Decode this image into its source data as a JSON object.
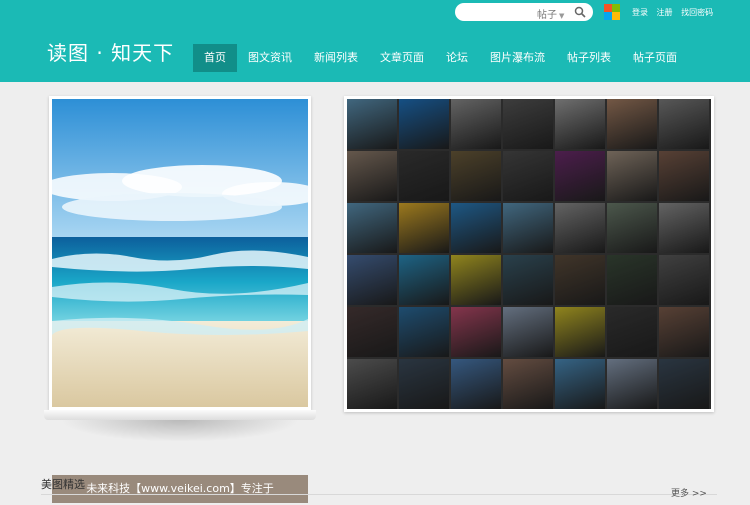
{
  "header": {
    "logo": "读图 · 知天下",
    "search": {
      "type_label": "帖子"
    },
    "top_links": [
      "登录",
      "注册",
      "找回密码"
    ],
    "nav": [
      "首页",
      "图文资讯",
      "新闻列表",
      "文章页面",
      "论坛",
      "图片瀑布流",
      "帖子列表",
      "帖子页面"
    ],
    "active_nav": 0
  },
  "feature": {
    "caption": "未来科技【www.veikei.com】专注于"
  },
  "gallery": {
    "tile_colors": [
      "#5a8fb0",
      "#1e6fb8",
      "#8a8a8a",
      "#555555",
      "#9a9a9a",
      "#a07a60",
      "#7a7a7a",
      "#8c7a6a",
      "#3a3a3a",
      "#6a5a3a",
      "#4a4a4a",
      "#6a2a6a",
      "#9a8a7a",
      "#7a5a4a",
      "#5a8fb0",
      "#d8a82a",
      "#2a7ab8",
      "#5a8fb0",
      "#8a8a8a",
      "#6a7a6a",
      "#8a8a8a",
      "#4a6a9a",
      "#2a8ab8",
      "#c8b82a",
      "#3a5a6a",
      "#5a4a3a",
      "#3a4a3a",
      "#5a5a5a",
      "#4a3a3a",
      "#2a6a9a",
      "#b84a6a",
      "#8a9ab0",
      "#c8b82a",
      "#3a3a3a",
      "#7a5a4a",
      "#6a6a6a",
      "#3a4a5a",
      "#4a7ab0",
      "#8a6a5a",
      "#4a8ab8",
      "#8a9ab0",
      "#3a4a5a"
    ]
  },
  "section": {
    "title": "美图精选",
    "more": "更多 >>"
  },
  "colors": {
    "header_bg": "#1bbab5",
    "nav_active": "#118e89",
    "page_bg": "#eeeeee"
  }
}
